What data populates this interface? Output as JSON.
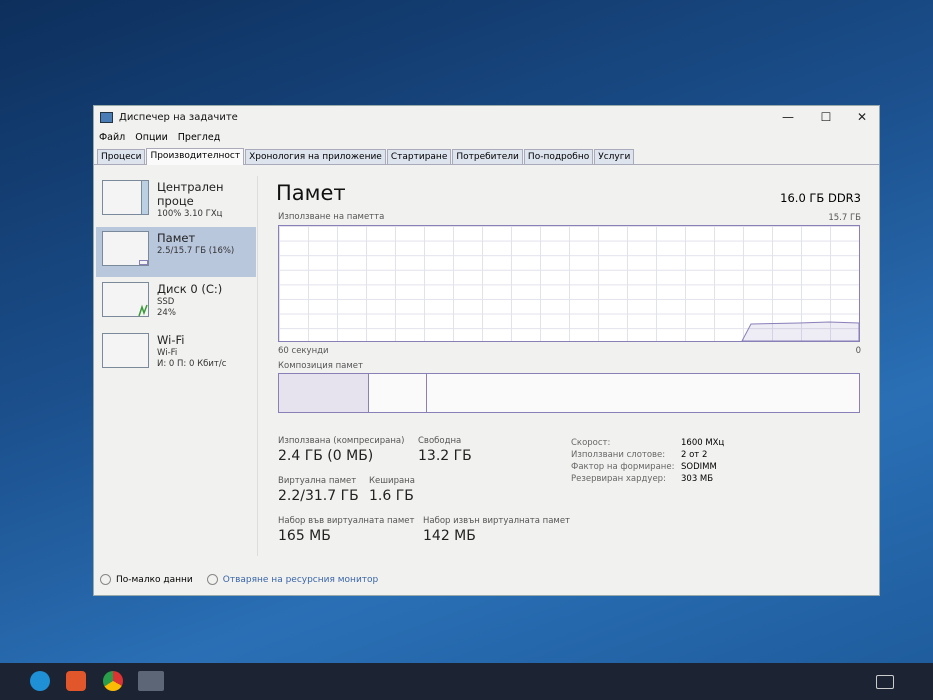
{
  "window": {
    "title": "Диспечер на задачите",
    "minimize": "—",
    "maximize": "☐",
    "close": "✕"
  },
  "menu": [
    "Файл",
    "Опции",
    "Преглед"
  ],
  "tabs": [
    "Процеси",
    "Производителност",
    "Хронология на приложение",
    "Стартиране",
    "Потребители",
    "По-подробно",
    "Услуги"
  ],
  "sidebar": [
    {
      "name": "Централен проце",
      "sub": "100% 3.10 ГХц"
    },
    {
      "name": "Памет",
      "sub": "2.5/15.7 ГБ (16%)"
    },
    {
      "name": "Диск 0 (C:)",
      "sub": "SSD",
      "sub2": "24%"
    },
    {
      "name": "Wi-Fi",
      "sub": "Wi-Fi",
      "sub2": "И: 0 П: 0 Кбит/с"
    }
  ],
  "main": {
    "title": "Памет",
    "type": "16.0 ГБ DDR3",
    "usage_label": "Използване на паметта",
    "max": "15.7 ГБ",
    "time_label": "60 секунди",
    "zero": "0",
    "composition_label": "Композиция памет",
    "usage_percent": 16
  },
  "stats": [
    {
      "label": "Използвана (компресирана)",
      "value": "2.4 ГБ (0 МБ)"
    },
    {
      "label": "Свободна",
      "value": "13.2 ГБ"
    },
    {
      "label": "Виртуална памет",
      "value": "2.2/31.7 ГБ"
    },
    {
      "label": "Кеширана",
      "value": "1.6 ГБ"
    },
    {
      "label": "Набор във виртуалната памет",
      "value": "165 МБ"
    },
    {
      "label": "Набор извън виртуалната памет",
      "value": "142 МБ"
    }
  ],
  "details": [
    {
      "k": "Скорост:",
      "v": "1600 MXц"
    },
    {
      "k": "Използвани слотове:",
      "v": "2 от 2"
    },
    {
      "k": "Фактор на формиране:",
      "v": "SODIMM"
    },
    {
      "k": "Резервиран хардуер:",
      "v": "303 МБ"
    }
  ],
  "footer": {
    "less": "По-малко данни",
    "monitor": "Отваряне на ресурсния монитор"
  }
}
